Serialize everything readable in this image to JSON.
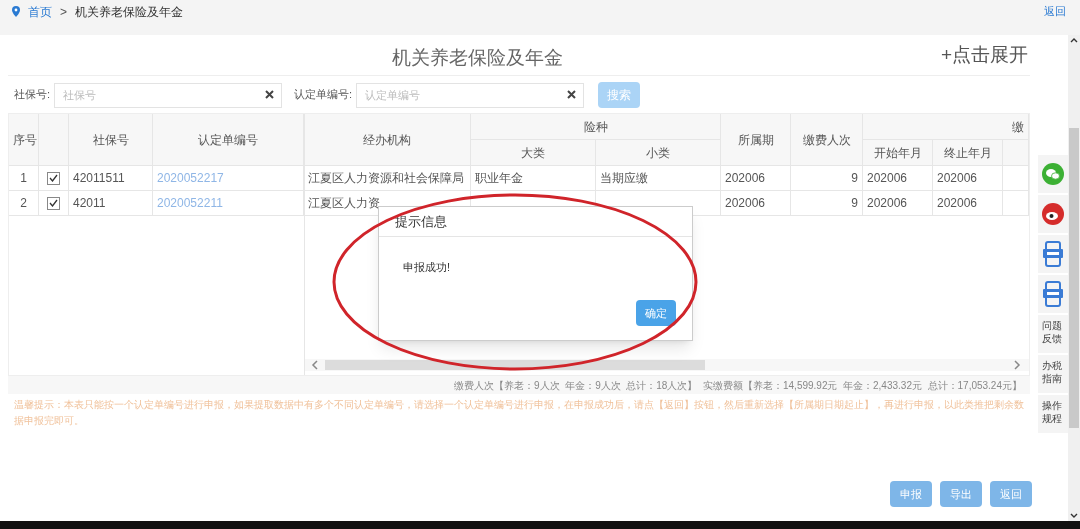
{
  "breadcrumb": {
    "home": "首页",
    "separator": ">",
    "current": "机关养老保险及年金",
    "back": "返回"
  },
  "title": "机关养老保险及年金",
  "expand": "+点击展开",
  "filters": [
    {
      "label": "社保号:",
      "placeholder": "社保号"
    },
    {
      "label": "认定单编号:",
      "placeholder": "认定单编号"
    }
  ],
  "search_button": {
    "label": "搜索",
    "disabled": true
  },
  "table": {
    "header": {
      "index": "序号",
      "ssn": "社保号",
      "cert": "认定单编号",
      "agency": "经办机构",
      "insurance": "险种",
      "major": "大类",
      "minor": "小类",
      "period": "所属期",
      "count": "缴费人次",
      "payment": "缴",
      "start": "开始年月",
      "end": "终止年月"
    },
    "rows": [
      {
        "index": "1",
        "checked": true,
        "ssn": "42011511",
        "cert": "2020052217",
        "agency": "江夏区人力资源和社会保障局",
        "major": "职业年金",
        "minor": "当期应缴",
        "period": "202006",
        "count": "9",
        "start": "202006",
        "end": "202006"
      },
      {
        "index": "2",
        "checked": true,
        "ssn": "42011",
        "cert": "2020052211",
        "agency": "江夏区人力资",
        "period": "202006",
        "count": "9",
        "start": "202006",
        "end": "202006"
      }
    ]
  },
  "summary": "缴费人次【养老：9人次  年金：9人次  总计：18人次】  实缴费额【养老：14,599.92元  年金：2,433.32元  总计：17,053.24元】",
  "hint": "温馨提示：本表只能按一个认定单编号进行申报，如果提取数据中有多个不同认定单编号，请选择一个认定单编号进行申报，在申报成功后，请点【返回】按钮，然后重新选择【所属期日期起止】，再进行申报，以此类推把剩余数据申报完即可。",
  "dialog": {
    "title": "提示信息",
    "message": "申报成功!",
    "button": "确定"
  },
  "sidebar": [
    {
      "kind": "wechat"
    },
    {
      "kind": "weibo"
    },
    {
      "kind": "app"
    },
    {
      "kind": "app"
    },
    {
      "kind": "text",
      "label": "问题反馈"
    },
    {
      "kind": "text",
      "label": "办税指南"
    },
    {
      "kind": "text",
      "label": "操作规程"
    }
  ],
  "actions": [
    {
      "label": "申报",
      "disabled": true
    },
    {
      "label": "导出",
      "disabled": true
    },
    {
      "label": "返回",
      "disabled": true
    }
  ]
}
